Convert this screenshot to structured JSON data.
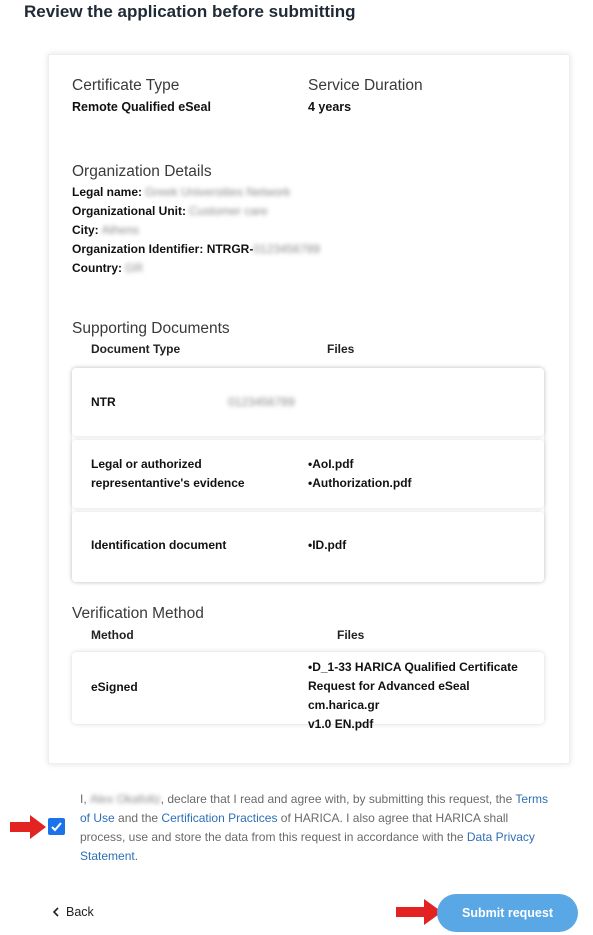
{
  "page": {
    "title": "Review the application before submitting"
  },
  "certificate": {
    "type_label": "Certificate Type",
    "type_value": "Remote Qualified eSeal",
    "duration_label": "Service Duration",
    "duration_value": "4 years"
  },
  "organization": {
    "title": "Organization Details",
    "legal_name_label": "Legal name:",
    "legal_name_value": "Greek Universities Network",
    "unit_label": "Organizational Unit:",
    "unit_value": "Customer care",
    "city_label": "City:",
    "city_value": "Athens",
    "identifier_label": "Organization Identifier:",
    "identifier_prefix": "NTRGR-",
    "identifier_value": "0123456789",
    "country_label": "Country:",
    "country_value": "GR"
  },
  "supporting_documents": {
    "title": "Supporting Documents",
    "col_type": "Document Type",
    "col_files": "Files",
    "rows": [
      {
        "type": "NTR",
        "files": [],
        "value": "0123456789"
      },
      {
        "type_line1": "Legal or authorized",
        "type_line2": "representantive's evidence",
        "files": [
          "AoI.pdf",
          "Authorization.pdf"
        ]
      },
      {
        "type": "Identification document",
        "files": [
          "ID.pdf"
        ]
      }
    ]
  },
  "verification": {
    "title": "Verification Method",
    "col_method": "Method",
    "col_files": "Files",
    "row": {
      "method": "eSigned",
      "file_line1": "D_1-33 HARICA Qualified Certificate",
      "file_line2": "Request for Advanced eSeal cm.harica.gr",
      "file_line3": "v1.0 EN.pdf"
    }
  },
  "consent": {
    "checked": true,
    "prefix": "I,",
    "name": "Alex Okafoltz",
    "text1": ", declare that I read and agree with, by submitting this request, the",
    "terms_link": "Terms of Use",
    "and": " and the ",
    "practices_link": "Certification Practices",
    "text2": " of HARICA. I also agree that HARICA shall process, use and store the data from this request in accordance with the ",
    "privacy_link": "Data Privacy Statement",
    "end": "."
  },
  "footer": {
    "back_label": "Back",
    "submit_label": "Submit request"
  },
  "colors": {
    "accent": "#5aa7e6",
    "link": "#2e6fb8",
    "checkbox": "#1a73e8",
    "arrow": "#e32222"
  }
}
